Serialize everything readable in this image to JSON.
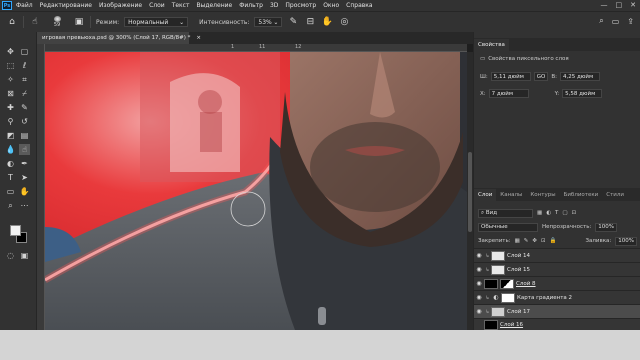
{
  "app": {
    "logo": "Ps"
  },
  "menu": [
    "Файл",
    "Редактирование",
    "Изображение",
    "Слои",
    "Текст",
    "Выделение",
    "Фильтр",
    "3D",
    "Просмотр",
    "Окно",
    "Справка"
  ],
  "window_controls": {
    "minimize": "—",
    "maximize": "□",
    "close": "✕"
  },
  "options": {
    "brush_size": "59",
    "mode_label": "Режим:",
    "mode_value": "Нормальный",
    "intensity_label": "Интенсивность:",
    "intensity_value": "53%"
  },
  "document": {
    "tab_title": "игровая превьюха.psd @ 300% (Слой 17, RGB/8#) *",
    "close": "×",
    "ruler_marks": [
      "1",
      "11",
      "12"
    ]
  },
  "properties": {
    "tab": "Свойства",
    "subtitle": "Свойства пиксельного слоя",
    "w_label": "Ш:",
    "w_value": "5,11 дюйм",
    "link": "GO",
    "h_label": "В:",
    "h_value": "4,25 дюйм",
    "x_label": "X:",
    "x_value": "7 дюйм",
    "y_label": "Y:",
    "y_value": "5,58 дюйм"
  },
  "layers_panel": {
    "tabs": [
      "Слои",
      "Каналы",
      "Контуры",
      "Библиотеки",
      "Стили"
    ],
    "filter_label": "Вид",
    "blend_mode": "Обычные",
    "opacity_label": "Непрозрачность:",
    "opacity_value": "100%",
    "lock_label": "Закрепить:",
    "fill_label": "Заливка:",
    "fill_value": "100%",
    "layers": [
      {
        "name": "Слой 14",
        "thumb": "#e8e8e8",
        "clipped": true
      },
      {
        "name": "Слой 15",
        "thumb": "#e8e8e8",
        "clipped": true
      },
      {
        "name": "Слой 8",
        "thumb": "#000000",
        "clipped": false
      },
      {
        "name": "Карта градиента 2",
        "thumb": "#ffffff",
        "clipped": true
      },
      {
        "name": "Слой 17",
        "thumb": "#cfcfcf",
        "clipped": true
      },
      {
        "name": "Слой 16",
        "thumb": "#000000",
        "clipped": false
      }
    ]
  },
  "colors": {
    "foreground": "#f2f2f2",
    "background": "#000000",
    "accent": "#31a8ff"
  }
}
